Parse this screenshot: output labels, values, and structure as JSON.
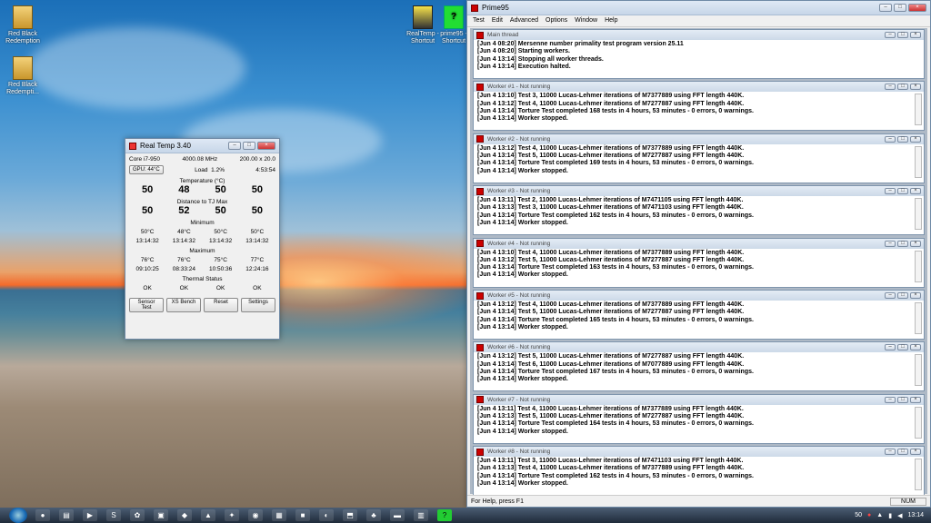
{
  "desktop": {
    "icons": [
      {
        "label": "Red Black Redemption"
      },
      {
        "label": "Red Black Redempti..."
      },
      {
        "label": "RealTemp - Shortcut"
      },
      {
        "label": "prime95 - Shortcut"
      }
    ]
  },
  "realtemp": {
    "title": "Real Temp 3.40",
    "cpu": "Core i7-950",
    "mhz": "4000.08 MHz",
    "ratio": "200.00 x 20.0",
    "gpu_button": "GPU: 44°C",
    "load_label": "Load",
    "load_value": "1.2%",
    "uptime": "4:53:54",
    "temperature_heading": "Temperature (°C)",
    "temperatures": [
      "50",
      "48",
      "50",
      "50"
    ],
    "distance_heading": "Distance to TJ Max",
    "distances": [
      "50",
      "52",
      "50",
      "50"
    ],
    "minimum_heading": "Minimum",
    "min_temps": [
      "50°C",
      "48°C",
      "50°C",
      "50°C"
    ],
    "min_times": [
      "13:14:32",
      "13:14:32",
      "13:14:32",
      "13:14:32"
    ],
    "maximum_heading": "Maximum",
    "max_temps": [
      "76°C",
      "76°C",
      "75°C",
      "77°C"
    ],
    "max_times": [
      "09:10:25",
      "08:33:24",
      "10:50:36",
      "12:24:16"
    ],
    "thermal_heading": "Thermal Status",
    "thermal": [
      "OK",
      "OK",
      "OK",
      "OK"
    ],
    "buttons": [
      "Sensor Test",
      "XS Bench",
      "Reset",
      "Settings"
    ]
  },
  "prime95": {
    "title": "Prime95",
    "menu": [
      "Test",
      "Edit",
      "Advanced",
      "Options",
      "Window",
      "Help"
    ],
    "status_left": "For Help, press F1",
    "status_right": "NUM",
    "panes": [
      {
        "title": "Main thread",
        "lines": [
          "[Jun 4 08:20] Mersenne number primality test program version 25.11",
          "[Jun 4 08:20] Starting workers.",
          "[Jun 4 13:14] Stopping all worker threads.",
          "[Jun 4 13:14] Execution halted."
        ]
      },
      {
        "title": "Worker #1 - Not running",
        "lines": [
          "[Jun 4 13:10] Test 3, 11000 Lucas-Lehmer iterations of M7377889 using FFT length 440K.",
          "[Jun 4 13:12] Test 4, 11000 Lucas-Lehmer iterations of M7277887 using FFT length 440K.",
          "[Jun 4 13:14] Torture Test completed 168 tests in 4 hours, 53 minutes - 0 errors, 0 warnings.",
          "[Jun 4 13:14] Worker stopped."
        ]
      },
      {
        "title": "Worker #2 - Not running",
        "lines": [
          "[Jun 4 13:12] Test 4, 11000 Lucas-Lehmer iterations of M7377889 using FFT length 440K.",
          "[Jun 4 13:14] Test 5, 11000 Lucas-Lehmer iterations of M7277887 using FFT length 440K.",
          "[Jun 4 13:14] Torture Test completed 169 tests in 4 hours, 53 minutes - 0 errors, 0 warnings.",
          "[Jun 4 13:14] Worker stopped."
        ]
      },
      {
        "title": "Worker #3 - Not running",
        "lines": [
          "[Jun 4 13:11] Test 2, 11000 Lucas-Lehmer iterations of M7471105 using FFT length 440K.",
          "[Jun 4 13:13] Test 3, 11000 Lucas-Lehmer iterations of M7471103 using FFT length 440K.",
          "[Jun 4 13:14] Torture Test completed 162 tests in 4 hours, 53 minutes - 0 errors, 0 warnings.",
          "[Jun 4 13:14] Worker stopped."
        ]
      },
      {
        "title": "Worker #4 - Not running",
        "lines": [
          "[Jun 4 13:10] Test 4, 11000 Lucas-Lehmer iterations of M7377889 using FFT length 440K.",
          "[Jun 4 13:12] Test 5, 11000 Lucas-Lehmer iterations of M7277887 using FFT length 440K.",
          "[Jun 4 13:14] Torture Test completed 163 tests in 4 hours, 53 minutes - 0 errors, 0 warnings.",
          "[Jun 4 13:14] Worker stopped."
        ]
      },
      {
        "title": "Worker #5 - Not running",
        "lines": [
          "[Jun 4 13:12] Test 4, 11000 Lucas-Lehmer iterations of M7377889 using FFT length 440K.",
          "[Jun 4 13:14] Test 5, 11000 Lucas-Lehmer iterations of M7277887 using FFT length 440K.",
          "[Jun 4 13:14] Torture Test completed 165 tests in 4 hours, 53 minutes - 0 errors, 0 warnings.",
          "[Jun 4 13:14] Worker stopped."
        ]
      },
      {
        "title": "Worker #6 - Not running",
        "lines": [
          "[Jun 4 13:12] Test 5, 11000 Lucas-Lehmer iterations of M7277887 using FFT length 440K.",
          "[Jun 4 13:14] Test 6, 11000 Lucas-Lehmer iterations of M7077889 using FFT length 440K.",
          "[Jun 4 13:14] Torture Test completed 167 tests in 4 hours, 53 minutes - 0 errors, 0 warnings.",
          "[Jun 4 13:14] Worker stopped."
        ]
      },
      {
        "title": "Worker #7 - Not running",
        "lines": [
          "[Jun 4 13:11] Test 4, 11000 Lucas-Lehmer iterations of M7377889 using FFT length 440K.",
          "[Jun 4 13:13] Test 5, 11000 Lucas-Lehmer iterations of M7277887 using FFT length 440K.",
          "[Jun 4 13:14] Torture Test completed 164 tests in 4 hours, 53 minutes - 0 errors, 0 warnings.",
          "[Jun 4 13:14] Worker stopped."
        ]
      },
      {
        "title": "Worker #8 - Not running",
        "lines": [
          "[Jun 4 13:11] Test 3, 11000 Lucas-Lehmer iterations of M7471103 using FFT length 440K.",
          "[Jun 4 13:13] Test 4, 11000 Lucas-Lehmer iterations of M7377889 using FFT length 440K.",
          "[Jun 4 13:14] Torture Test completed 162 tests in 4 hours, 53 minutes - 0 errors, 0 warnings.",
          "[Jun 4 13:14] Worker stopped."
        ]
      }
    ]
  },
  "taskbar": {
    "tray_temp": "50",
    "clock": "13:14"
  }
}
